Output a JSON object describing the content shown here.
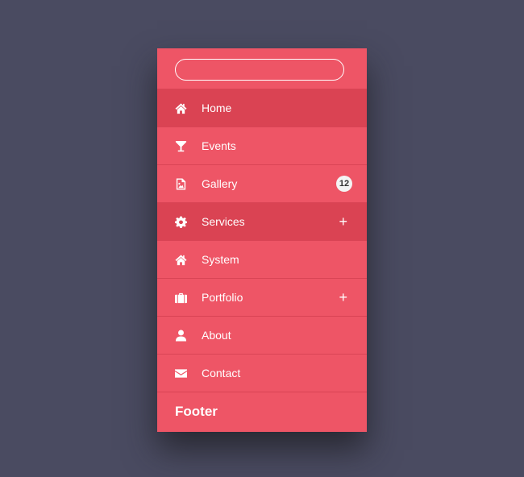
{
  "search": {
    "placeholder": "",
    "value": ""
  },
  "menu": {
    "items": [
      {
        "label": "Home",
        "icon": "home-icon",
        "active": true
      },
      {
        "label": "Events",
        "icon": "cocktail-glass-icon"
      },
      {
        "label": "Gallery",
        "icon": "image-file-icon",
        "badge": "12"
      },
      {
        "label": "Services",
        "icon": "gear-icon",
        "active": true,
        "expand": "+"
      },
      {
        "label": "System",
        "icon": "home-icon"
      },
      {
        "label": "Portfolio",
        "icon": "briefcase-icon",
        "expand": "+"
      },
      {
        "label": "About",
        "icon": "user-icon"
      },
      {
        "label": "Contact",
        "icon": "envelope-icon"
      }
    ]
  },
  "footer": {
    "label": "Footer"
  },
  "colors": {
    "panel": "#ee5566",
    "active": "#da4353",
    "background": "#4a4b61",
    "badge": "#f4f4f4"
  }
}
